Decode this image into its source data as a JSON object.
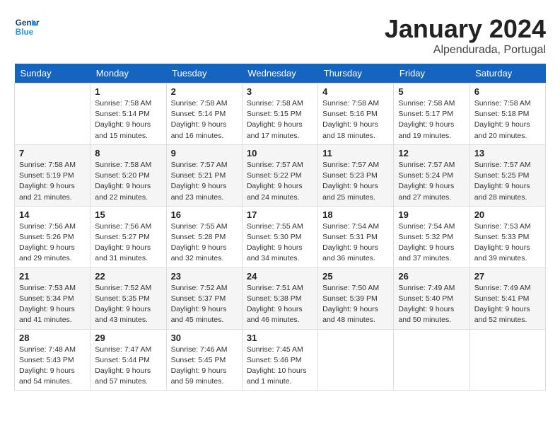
{
  "header": {
    "logo_line1": "General",
    "logo_line2": "Blue",
    "month": "January 2024",
    "location": "Alpendurada, Portugal"
  },
  "weekdays": [
    "Sunday",
    "Monday",
    "Tuesday",
    "Wednesday",
    "Thursday",
    "Friday",
    "Saturday"
  ],
  "weeks": [
    [
      {
        "day": "",
        "empty": true
      },
      {
        "day": "1",
        "sunrise": "7:58 AM",
        "sunset": "5:14 PM",
        "daylight": "9 hours and 15 minutes."
      },
      {
        "day": "2",
        "sunrise": "7:58 AM",
        "sunset": "5:14 PM",
        "daylight": "9 hours and 16 minutes."
      },
      {
        "day": "3",
        "sunrise": "7:58 AM",
        "sunset": "5:15 PM",
        "daylight": "9 hours and 17 minutes."
      },
      {
        "day": "4",
        "sunrise": "7:58 AM",
        "sunset": "5:16 PM",
        "daylight": "9 hours and 18 minutes."
      },
      {
        "day": "5",
        "sunrise": "7:58 AM",
        "sunset": "5:17 PM",
        "daylight": "9 hours and 19 minutes."
      },
      {
        "day": "6",
        "sunrise": "7:58 AM",
        "sunset": "5:18 PM",
        "daylight": "9 hours and 20 minutes."
      }
    ],
    [
      {
        "day": "7",
        "sunrise": "7:58 AM",
        "sunset": "5:19 PM",
        "daylight": "9 hours and 21 minutes."
      },
      {
        "day": "8",
        "sunrise": "7:58 AM",
        "sunset": "5:20 PM",
        "daylight": "9 hours and 22 minutes."
      },
      {
        "day": "9",
        "sunrise": "7:57 AM",
        "sunset": "5:21 PM",
        "daylight": "9 hours and 23 minutes."
      },
      {
        "day": "10",
        "sunrise": "7:57 AM",
        "sunset": "5:22 PM",
        "daylight": "9 hours and 24 minutes."
      },
      {
        "day": "11",
        "sunrise": "7:57 AM",
        "sunset": "5:23 PM",
        "daylight": "9 hours and 25 minutes."
      },
      {
        "day": "12",
        "sunrise": "7:57 AM",
        "sunset": "5:24 PM",
        "daylight": "9 hours and 27 minutes."
      },
      {
        "day": "13",
        "sunrise": "7:57 AM",
        "sunset": "5:25 PM",
        "daylight": "9 hours and 28 minutes."
      }
    ],
    [
      {
        "day": "14",
        "sunrise": "7:56 AM",
        "sunset": "5:26 PM",
        "daylight": "9 hours and 29 minutes."
      },
      {
        "day": "15",
        "sunrise": "7:56 AM",
        "sunset": "5:27 PM",
        "daylight": "9 hours and 31 minutes."
      },
      {
        "day": "16",
        "sunrise": "7:55 AM",
        "sunset": "5:28 PM",
        "daylight": "9 hours and 32 minutes."
      },
      {
        "day": "17",
        "sunrise": "7:55 AM",
        "sunset": "5:30 PM",
        "daylight": "9 hours and 34 minutes."
      },
      {
        "day": "18",
        "sunrise": "7:54 AM",
        "sunset": "5:31 PM",
        "daylight": "9 hours and 36 minutes."
      },
      {
        "day": "19",
        "sunrise": "7:54 AM",
        "sunset": "5:32 PM",
        "daylight": "9 hours and 37 minutes."
      },
      {
        "day": "20",
        "sunrise": "7:53 AM",
        "sunset": "5:33 PM",
        "daylight": "9 hours and 39 minutes."
      }
    ],
    [
      {
        "day": "21",
        "sunrise": "7:53 AM",
        "sunset": "5:34 PM",
        "daylight": "9 hours and 41 minutes."
      },
      {
        "day": "22",
        "sunrise": "7:52 AM",
        "sunset": "5:35 PM",
        "daylight": "9 hours and 43 minutes."
      },
      {
        "day": "23",
        "sunrise": "7:52 AM",
        "sunset": "5:37 PM",
        "daylight": "9 hours and 45 minutes."
      },
      {
        "day": "24",
        "sunrise": "7:51 AM",
        "sunset": "5:38 PM",
        "daylight": "9 hours and 46 minutes."
      },
      {
        "day": "25",
        "sunrise": "7:50 AM",
        "sunset": "5:39 PM",
        "daylight": "9 hours and 48 minutes."
      },
      {
        "day": "26",
        "sunrise": "7:49 AM",
        "sunset": "5:40 PM",
        "daylight": "9 hours and 50 minutes."
      },
      {
        "day": "27",
        "sunrise": "7:49 AM",
        "sunset": "5:41 PM",
        "daylight": "9 hours and 52 minutes."
      }
    ],
    [
      {
        "day": "28",
        "sunrise": "7:48 AM",
        "sunset": "5:43 PM",
        "daylight": "9 hours and 54 minutes."
      },
      {
        "day": "29",
        "sunrise": "7:47 AM",
        "sunset": "5:44 PM",
        "daylight": "9 hours and 57 minutes."
      },
      {
        "day": "30",
        "sunrise": "7:46 AM",
        "sunset": "5:45 PM",
        "daylight": "9 hours and 59 minutes."
      },
      {
        "day": "31",
        "sunrise": "7:45 AM",
        "sunset": "5:46 PM",
        "daylight": "10 hours and 1 minute."
      },
      {
        "day": "",
        "empty": true
      },
      {
        "day": "",
        "empty": true
      },
      {
        "day": "",
        "empty": true
      }
    ]
  ]
}
